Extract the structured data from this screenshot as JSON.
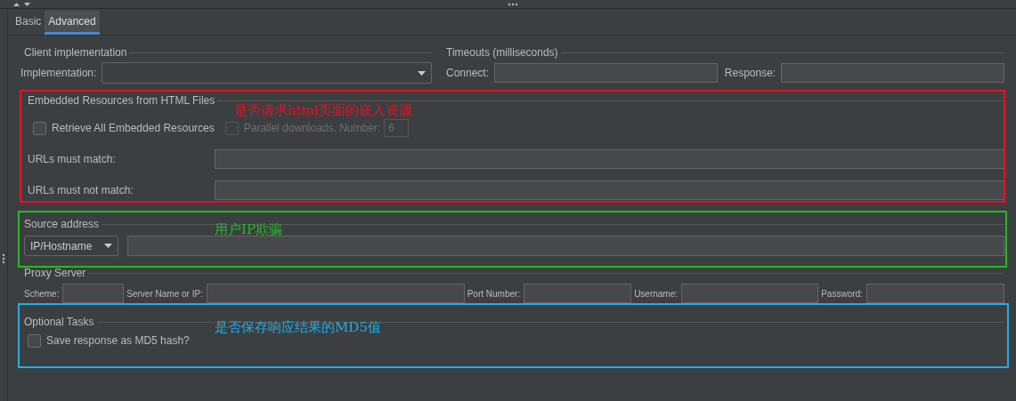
{
  "tabs": [
    {
      "label": "Basic",
      "selected": false
    },
    {
      "label": "Advanced",
      "selected": true
    }
  ],
  "client_implementation": {
    "title": "Client implementation",
    "implementation_label": "Implementation:"
  },
  "timeouts": {
    "title": "Timeouts (milliseconds)",
    "connect_label": "Connect:",
    "response_label": "Response:"
  },
  "embedded_resources": {
    "title": "Embedded Resources from HTML Files",
    "retrieve_all": {
      "label": "Retrieve All Embedded Resources",
      "checked": false
    },
    "parallel_downloads": {
      "label": "Parallel downloads. Number:",
      "checked": false,
      "disabled": true,
      "value": "6"
    },
    "urls_must_match_label": "URLs must match:",
    "urls_must_not_match_label": "URLs must not match:"
  },
  "source_address": {
    "title": "Source address",
    "type_value": "IP/Hostname"
  },
  "proxy_server": {
    "title": "Proxy Server",
    "fields": [
      {
        "label": "Scheme:"
      },
      {
        "label": "Server Name or IP:"
      },
      {
        "label": "Port Number:"
      },
      {
        "label": "Username:"
      },
      {
        "label": "Password:"
      }
    ]
  },
  "optional_tasks": {
    "title": "Optional Tasks",
    "save_md5": {
      "label": "Save response as MD5 hash?",
      "checked": false
    }
  },
  "annotations": [
    {
      "text": "是否请求html页面的嵌入资源",
      "color": "#e81123"
    },
    {
      "text": "用户IP欺骗",
      "color": "#22bb22"
    },
    {
      "text": "是否保存响应结果的MD5值",
      "color": "#1eaee8"
    }
  ]
}
